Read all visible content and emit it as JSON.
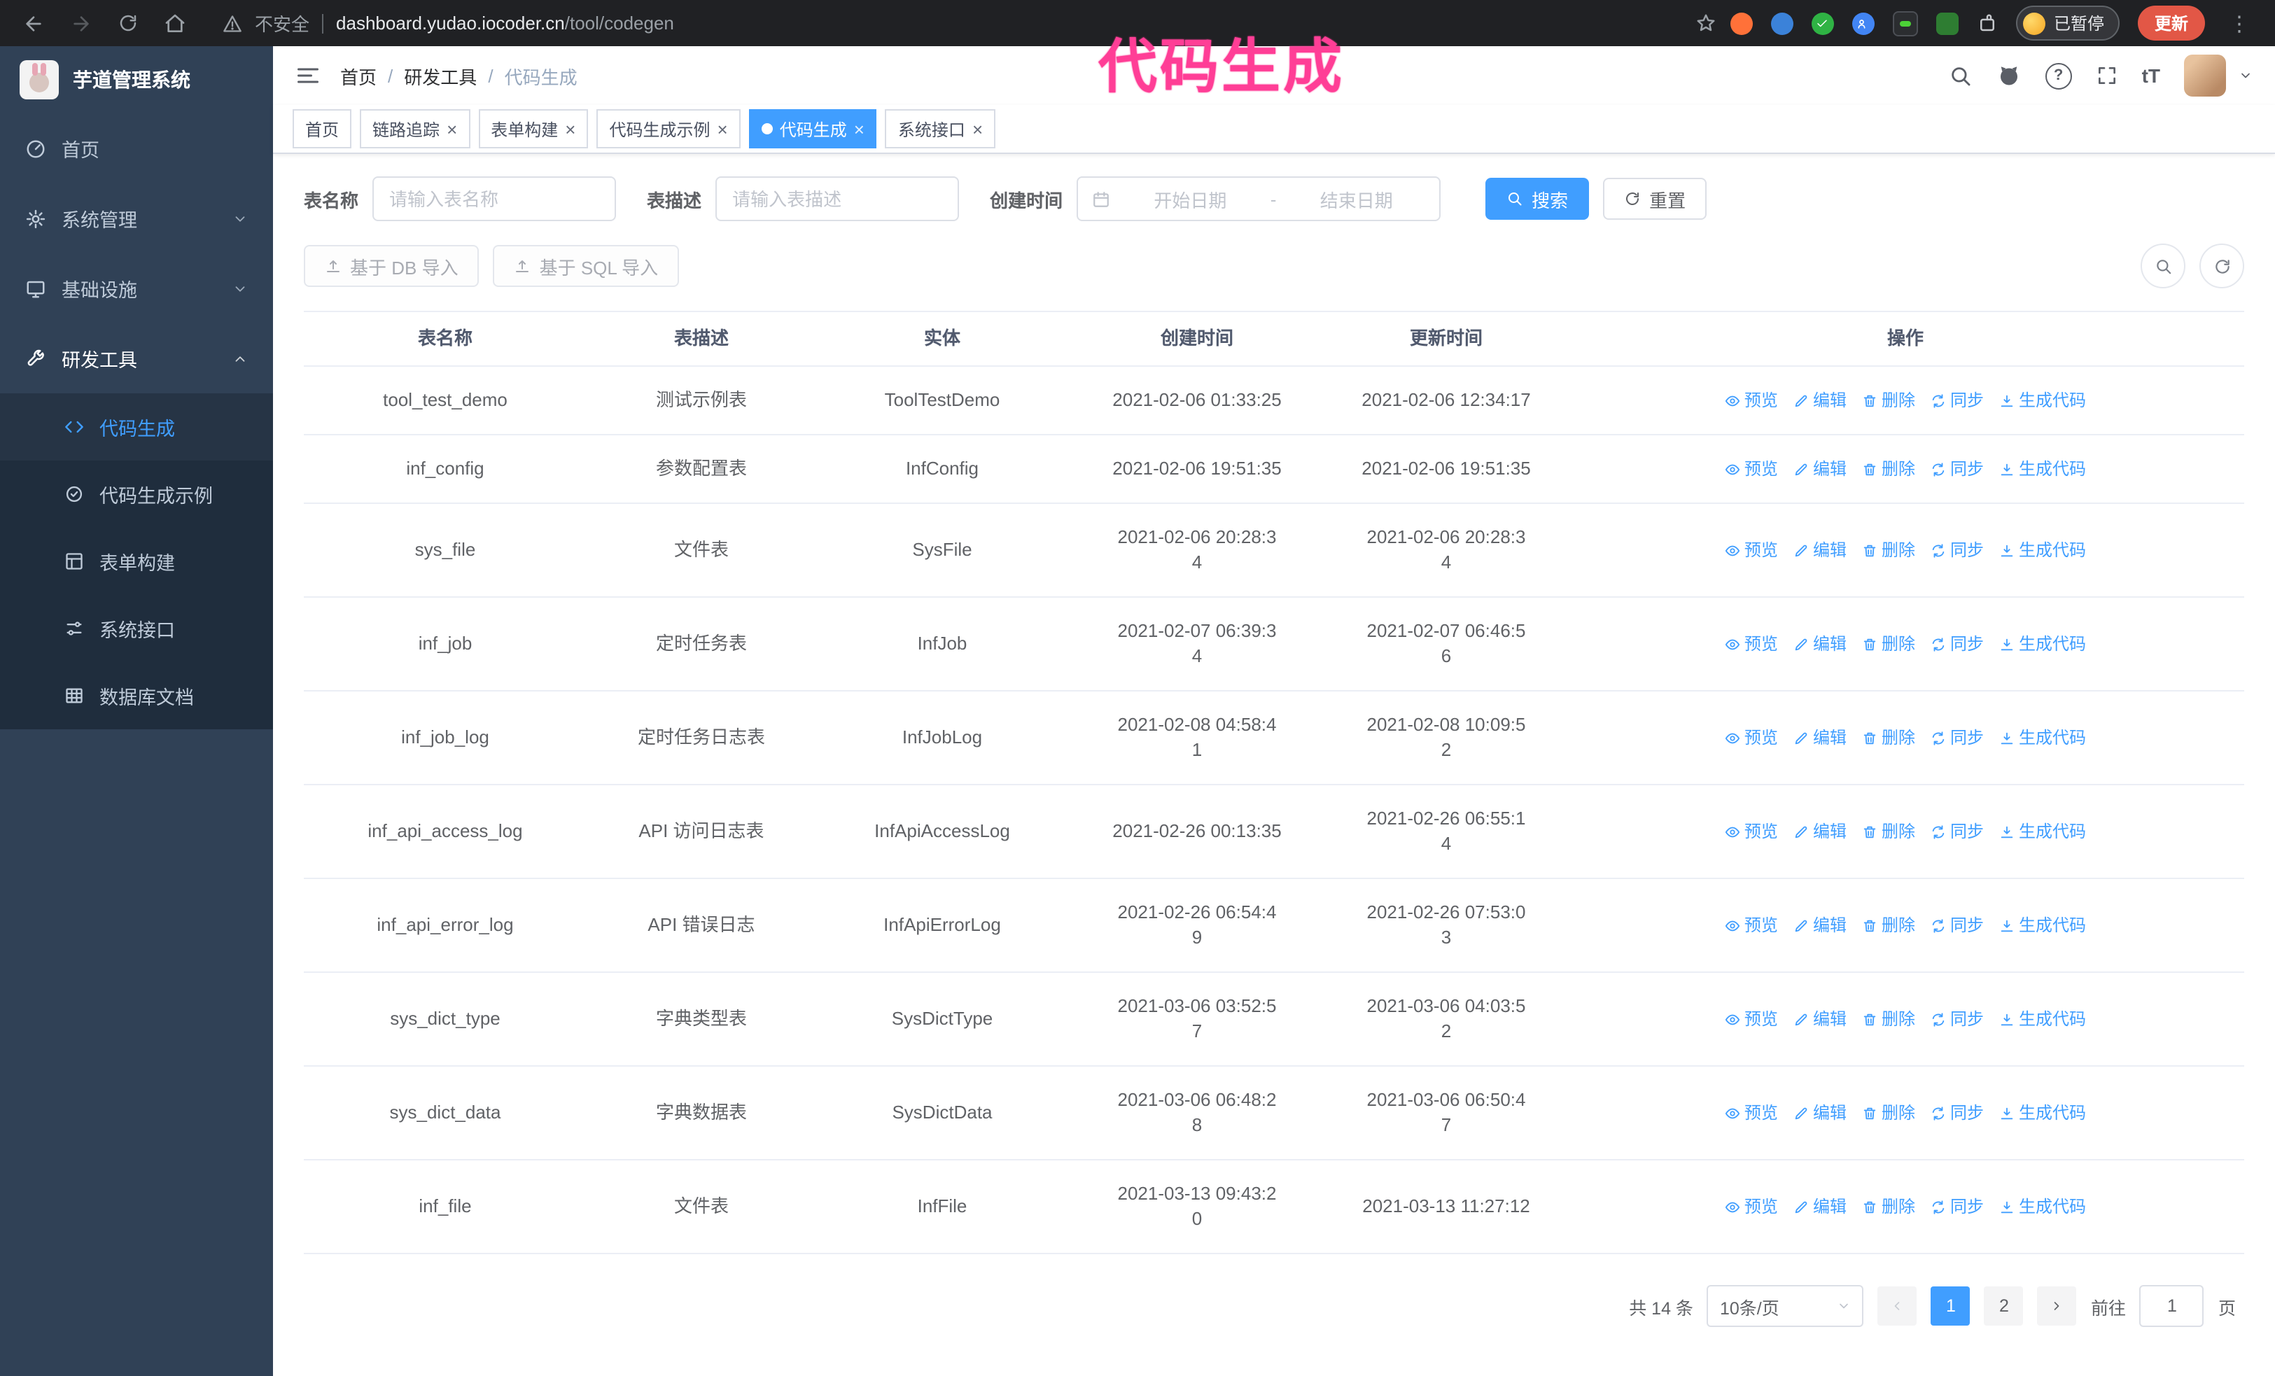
{
  "annotation": {
    "text": "代码生成",
    "color": "#ff3e96"
  },
  "browser": {
    "security_label": "不安全",
    "url_host": "dashboard.yudao.iocoder.cn",
    "url_path": "/tool/codegen",
    "paused_badge": "已暂停",
    "update_button": "更新"
  },
  "icons": {
    "close": "×",
    "kebab": "⋮",
    "question": "?",
    "font_size": "tT"
  },
  "sidebar": {
    "logo_title": "芋道管理系统",
    "items": [
      {
        "label": "首页"
      },
      {
        "label": "系统管理"
      },
      {
        "label": "基础设施"
      },
      {
        "label": "研发工具"
      }
    ],
    "sub_items": [
      {
        "label": "代码生成"
      },
      {
        "label": "代码生成示例"
      },
      {
        "label": "表单构建"
      },
      {
        "label": "系统接口"
      },
      {
        "label": "数据库文档"
      }
    ]
  },
  "header": {
    "breadcrumb": [
      "首页",
      "研发工具",
      "代码生成"
    ],
    "breadcrumb_separator": "/"
  },
  "tabs": [
    {
      "label": "首页"
    },
    {
      "label": "链路追踪"
    },
    {
      "label": "表单构建"
    },
    {
      "label": "代码生成示例"
    },
    {
      "label": "代码生成"
    },
    {
      "label": "系统接口"
    }
  ],
  "filters": {
    "table_name_label": "表名称",
    "table_name_placeholder": "请输入表名称",
    "table_desc_label": "表描述",
    "table_desc_placeholder": "请输入表描述",
    "create_time_label": "创建时间",
    "date_start_placeholder": "开始日期",
    "date_separator": "-",
    "date_end_placeholder": "结束日期",
    "search_button": "搜索",
    "reset_button": "重置"
  },
  "toolbar": {
    "import_db_button": "基于 DB 导入",
    "import_sql_button": "基于 SQL 导入"
  },
  "table": {
    "columns": [
      "表名称",
      "表描述",
      "实体",
      "创建时间",
      "更新时间",
      "操作"
    ],
    "actions": [
      "预览",
      "编辑",
      "删除",
      "同步",
      "生成代码"
    ],
    "rows": [
      {
        "name": "tool_test_demo",
        "desc": "测试示例表",
        "entity": "ToolTestDemo",
        "created": "2021-02-06 01:33:25",
        "updated": "2021-02-06 12:34:17"
      },
      {
        "name": "inf_config",
        "desc": "参数配置表",
        "entity": "InfConfig",
        "created": "2021-02-06 19:51:35",
        "updated": "2021-02-06 19:51:35"
      },
      {
        "name": "sys_file",
        "desc": "文件表",
        "entity": "SysFile",
        "created": "2021-02-06 20:28:3\n4",
        "updated": "2021-02-06 20:28:3\n4"
      },
      {
        "name": "inf_job",
        "desc": "定时任务表",
        "entity": "InfJob",
        "created": "2021-02-07 06:39:3\n4",
        "updated": "2021-02-07 06:46:5\n6"
      },
      {
        "name": "inf_job_log",
        "desc": "定时任务日志表",
        "entity": "InfJobLog",
        "created": "2021-02-08 04:58:4\n1",
        "updated": "2021-02-08 10:09:5\n2"
      },
      {
        "name": "inf_api_access_log",
        "desc": "API 访问日志表",
        "entity": "InfApiAccessLog",
        "created": "2021-02-26 00:13:35",
        "updated": "2021-02-26 06:55:1\n4"
      },
      {
        "name": "inf_api_error_log",
        "desc": "API 错误日志",
        "entity": "InfApiErrorLog",
        "created": "2021-02-26 06:54:4\n9",
        "updated": "2021-02-26 07:53:0\n3"
      },
      {
        "name": "sys_dict_type",
        "desc": "字典类型表",
        "entity": "SysDictType",
        "created": "2021-03-06 03:52:5\n7",
        "updated": "2021-03-06 04:03:5\n2"
      },
      {
        "name": "sys_dict_data",
        "desc": "字典数据表",
        "entity": "SysDictData",
        "created": "2021-03-06 06:48:2\n8",
        "updated": "2021-03-06 06:50:4\n7"
      },
      {
        "name": "inf_file",
        "desc": "文件表",
        "entity": "InfFile",
        "created": "2021-03-13 09:43:2\n0",
        "updated": "2021-03-13 11:27:12"
      }
    ]
  },
  "pagination": {
    "total_text": "共 14 条",
    "page_size": "10条/页",
    "pages": [
      "1",
      "2"
    ],
    "current_page": "1",
    "goto_label": "前往",
    "goto_value": "1",
    "goto_suffix": "页"
  },
  "colors": {
    "accent": "#409eff",
    "sidebar_bg": "#304156",
    "submenu_bg": "#1f2d3d",
    "chrome_bg": "#202124",
    "annotation": "#ff3e96",
    "update_button": "#e25746"
  }
}
